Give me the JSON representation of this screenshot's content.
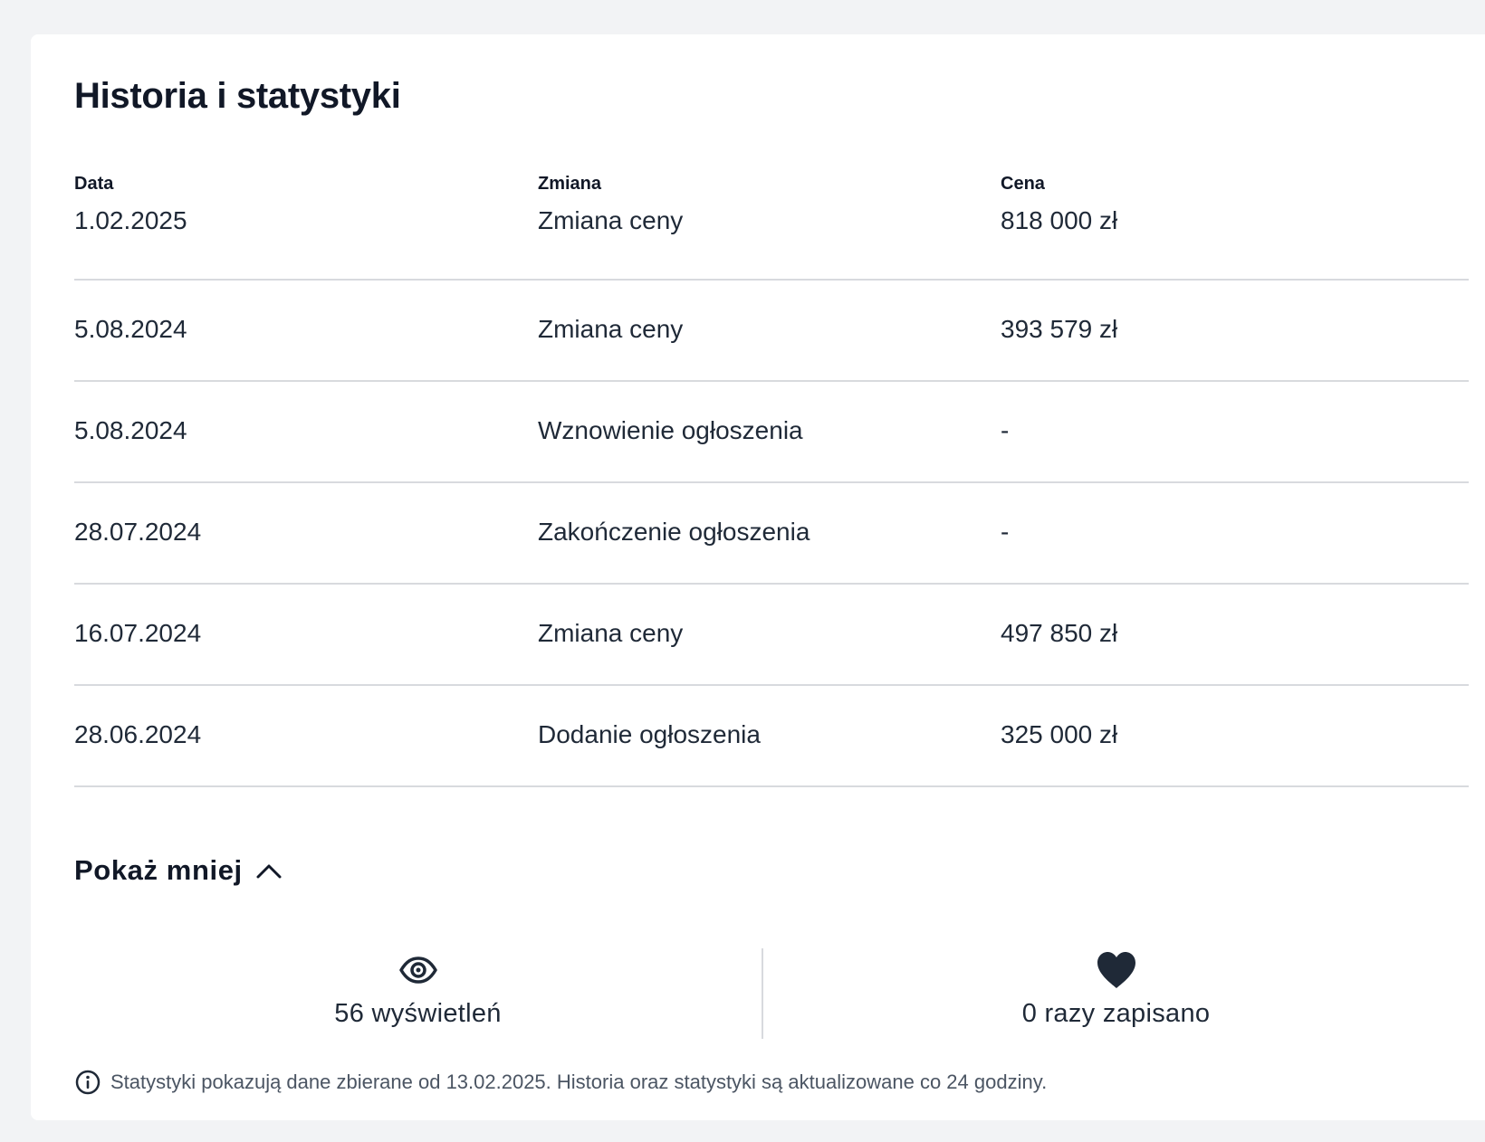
{
  "section": {
    "title": "Historia i statystyki"
  },
  "history_table": {
    "headers": [
      "Data",
      "Zmiana",
      "Cena"
    ],
    "rows": [
      {
        "date": "1.02.2025",
        "change": "Zmiana ceny",
        "price": "818 000 zł"
      },
      {
        "date": "5.08.2024",
        "change": "Zmiana ceny",
        "price": "393 579 zł"
      },
      {
        "date": "5.08.2024",
        "change": "Wznowienie ogłoszenia",
        "price": "-"
      },
      {
        "date": "28.07.2024",
        "change": "Zakończenie ogłoszenia",
        "price": "-"
      },
      {
        "date": "16.07.2024",
        "change": "Zmiana ceny",
        "price": "497 850 zł"
      },
      {
        "date": "28.06.2024",
        "change": "Dodanie ogłoszenia",
        "price": "325 000 zł"
      }
    ]
  },
  "toggle": {
    "label": "Pokaż mniej",
    "icon": "chevron-up-icon"
  },
  "stats": {
    "views": {
      "icon": "eye-icon",
      "text": "56 wyświetleń"
    },
    "saves": {
      "icon": "heart-icon",
      "text": "0 razy zapisano"
    }
  },
  "note": {
    "icon": "info-icon",
    "text": "Statystyki pokazują dane zbierane od 13.02.2025. Historia oraz statystyki są aktualizowane co 24 godziny."
  },
  "colors": {
    "background": "#f2f3f5",
    "card": "#ffffff",
    "text": "#1f2937",
    "divider": "#d8dade"
  }
}
